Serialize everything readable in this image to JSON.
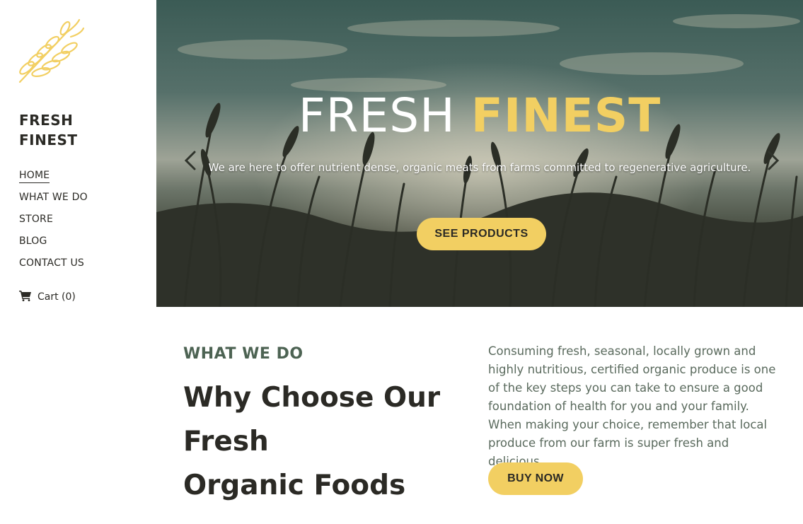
{
  "brand": {
    "name_line1": "FRESH",
    "name_line2": "FINEST",
    "logo_icon": "wheat-icon",
    "accent_color": "#f2cf62"
  },
  "nav": {
    "items": [
      {
        "label": "HOME",
        "active": true
      },
      {
        "label": "WHAT WE DO",
        "active": false
      },
      {
        "label": "STORE",
        "active": false
      },
      {
        "label": "BLOG",
        "active": false
      },
      {
        "label": "CONTACT US",
        "active": false
      }
    ],
    "cart_label": "Cart (0)",
    "cart_icon": "shopping-cart-icon"
  },
  "hero": {
    "title_light": "FRESH",
    "title_accent": "FINEST",
    "subtitle": "We are here to offer nutrient dense, organic meats from farms committed to regenerative agriculture.",
    "cta_label": "SEE PRODUCTS",
    "prev_icon": "chevron-left-icon",
    "next_icon": "chevron-right-icon"
  },
  "about": {
    "label": "WHAT WE DO",
    "heading_lines": [
      "Why Choose Our",
      "Fresh",
      "Organic Foods"
    ],
    "text": "Consuming fresh, seasonal, locally grown and highly nutritious, certified organic produce is one of the key steps you can take to ensure a good foundation of health for you and your family. When making your choice, remember that local produce from our farm is super fresh and delicious.",
    "cta_label": "BUY NOW"
  }
}
